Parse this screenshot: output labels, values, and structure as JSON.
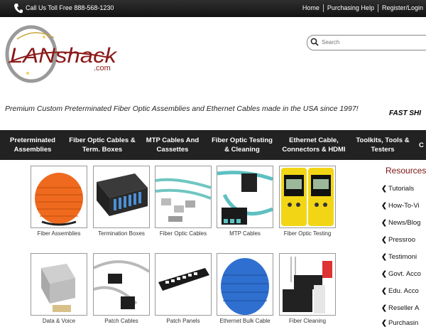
{
  "topbar": {
    "toll_free": "Call Us Toll Free 888-568-1230",
    "links": [
      "Home",
      "Purchasing Help",
      "Register/Login"
    ]
  },
  "logo": {
    "brand": "LANshack",
    "suffix": ".com"
  },
  "search": {
    "placeholder": "Search"
  },
  "tagline": "Premium Custom Preterminated Fiber Optic Assemblies and Ethernet Cables made in the USA since 1997!",
  "fast_ship": "FAST SHI",
  "nav": [
    {
      "line1": "Preterminated",
      "line2": "Assemblies"
    },
    {
      "line1": "Fiber Optic Cables &",
      "line2": "Term. Boxes"
    },
    {
      "line1": "MTP Cables And",
      "line2": "Cassettes"
    },
    {
      "line1": "Fiber Optic Testing",
      "line2": "& Cleaning"
    },
    {
      "line1": "Ethernet Cable,",
      "line2": "Connectors & HDMI"
    },
    {
      "line1": "Toolkits, Tools &",
      "line2": "Testers"
    },
    {
      "line1": "C",
      "line2": ""
    }
  ],
  "products_row1": [
    "Fiber Assemblies",
    "Termination Boxes",
    "Fiber Optic Cables",
    "MTP Cables",
    "Fiber Optic Testing"
  ],
  "products_row2": [
    "Data & Voice",
    "Patch Cables",
    "Patch Panels",
    "Ethernet Bulk Cable",
    "Fiber Cleaning"
  ],
  "resources": {
    "title": "Resources",
    "items": [
      "Tutorials",
      "How-To-Vi",
      "News/Blog",
      "Pressroo",
      "Testimoni",
      "Govt. Acco",
      "Edu. Acco",
      "Reseller A",
      "Purchasin"
    ]
  },
  "colors": {
    "nav_bg": "#222222",
    "topbar_bg": "#1a1a1a",
    "resources_title": "#7a1414",
    "logo_red": "#8b1a1a"
  }
}
